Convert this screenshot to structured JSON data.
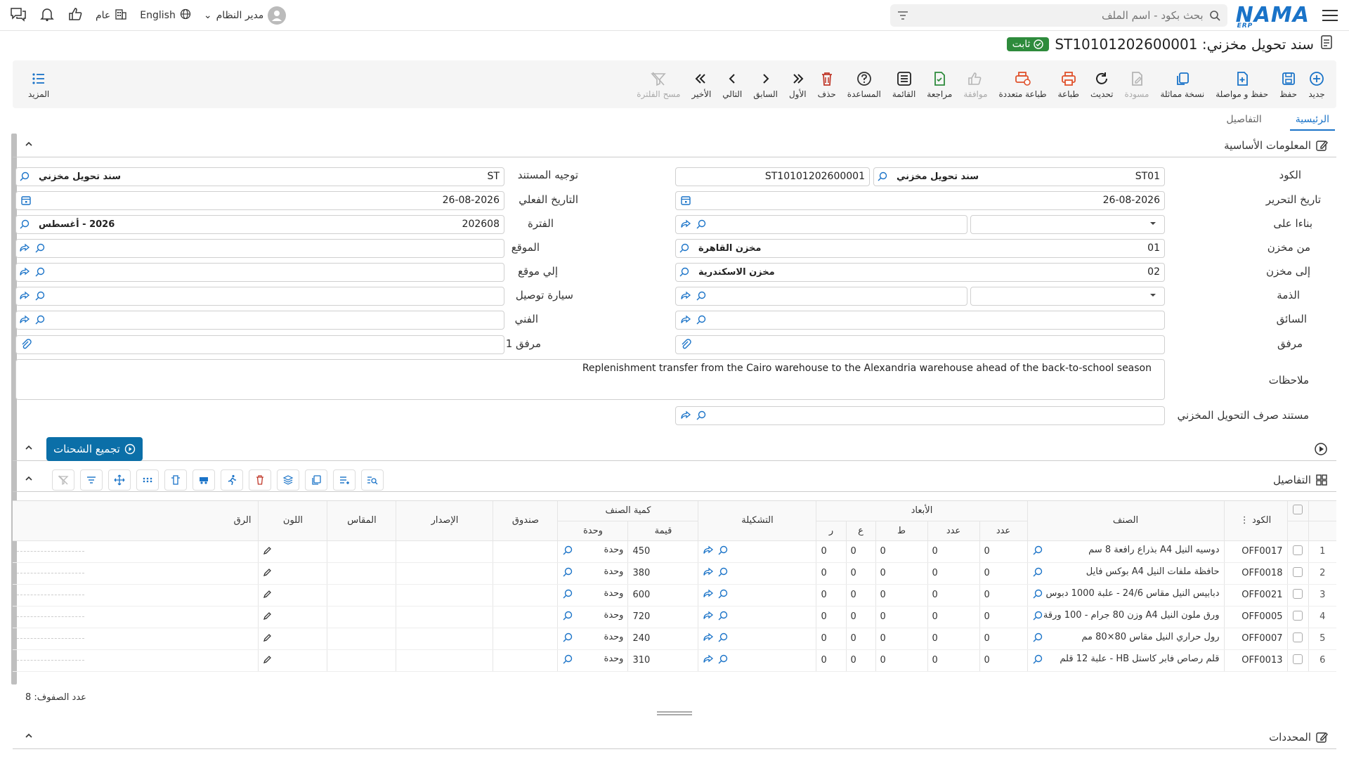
{
  "topbar": {
    "logo": "NAMA",
    "logo_sub": "ERP",
    "search_placeholder": "بحث بكود - اسم الملف",
    "user": "مدير النظام",
    "language": "English",
    "scope": "عام"
  },
  "title": {
    "text": "سند تحويل مخزني: ST10101202600001",
    "status": "ثابت"
  },
  "toolbar": {
    "items": [
      {
        "label": "جديد",
        "icon": "plus-circle-icon"
      },
      {
        "label": "حفظ",
        "icon": "save-icon"
      },
      {
        "label": "حفظ و مواصلة",
        "icon": "save-continue-icon"
      },
      {
        "label": "نسخة مماثلة",
        "icon": "copy-icon"
      },
      {
        "label": "مسودة",
        "icon": "draft-icon"
      },
      {
        "label": "تحديث",
        "icon": "refresh-icon"
      },
      {
        "label": "طباعة",
        "icon": "print-icon"
      },
      {
        "label": "طباعة متعددة",
        "icon": "multi-print-icon"
      },
      {
        "label": "موافقة",
        "icon": "thumbs-up-icon"
      },
      {
        "label": "مراجعة",
        "icon": "review-icon"
      },
      {
        "label": "القائمة",
        "icon": "list-icon"
      },
      {
        "label": "المساعدة",
        "icon": "help-icon"
      },
      {
        "label": "حذف",
        "icon": "trash-icon"
      },
      {
        "label": "الأول",
        "icon": "first-icon"
      },
      {
        "label": "السابق",
        "icon": "prev-icon"
      },
      {
        "label": "التالي",
        "icon": "next-icon"
      },
      {
        "label": "الأخير",
        "icon": "last-icon"
      },
      {
        "label": "مسح الفلترة",
        "icon": "clear-filter-icon"
      }
    ],
    "more": "المزيد"
  },
  "tabs": [
    "الرئيسية",
    "التفاصيل"
  ],
  "basic_section": "المعلومات الأساسية",
  "form": {
    "code_label": "الكود",
    "code_value": "ST01",
    "code_name": "سند تحويل مخزني",
    "code_number": "ST10101202600001",
    "doc_direction_label": "توجيه المستند",
    "doc_direction_value": "ST",
    "doc_direction_name": "سند تحويل مخزني",
    "edit_date_label": "تاريخ التحرير",
    "edit_date_value": "26-08-2026",
    "actual_date_label": "التاريخ الفعلي",
    "actual_date_value": "26-08-2026",
    "based_on_label": "بناءا على",
    "period_label": "الفترة",
    "period_value": "202608",
    "period_name": "2026 - أغسطس",
    "from_store_label": "من مخزن",
    "from_store_code": "01",
    "from_store_name": "مخزن القاهرة",
    "location_label": "الموقع",
    "to_store_label": "إلى مخزن",
    "to_store_code": "02",
    "to_store_name": "مخزن الاسكندرية",
    "to_location_label": "إلي موقع",
    "account_label": "الذمة",
    "vehicle_label": "سيارة توصيل",
    "driver_label": "السائق",
    "technician_label": "الفني",
    "attachment_label": "مرفق",
    "attachment1_label": "مرفق 1",
    "notes_label": "ملاحظات",
    "notes_value": "Replenishment transfer from the Cairo warehouse to the Alexandria warehouse ahead of the back-to-school season",
    "issue_doc_label": "مستند صرف التحويل المخزني"
  },
  "shipments_button": "تجميع الشحنات",
  "details_section": "التفاصيل",
  "grid": {
    "headers": {
      "code": "الكود",
      "item": "الصنف",
      "dimensions": "الأبعاد",
      "count1": "عدد",
      "count2": "عدد",
      "length": "ط",
      "width": "ع",
      "radius": "ر",
      "config": "التشكيلة",
      "qty_group": "كمية الصنف",
      "value": "قيمة",
      "unit": "وحدة",
      "box": "صندوق",
      "version": "الإصدار",
      "size": "المقاس",
      "color": "اللون",
      "serial": "الرق"
    },
    "rows": [
      {
        "n": "1",
        "code": "OFF0017",
        "item": "دوسيه النيل A4 بذراع رافعة 8 سم",
        "c1": "0",
        "c2": "0",
        "l": "0",
        "w": "0",
        "r": "0",
        "value": "450",
        "unit": "وحدة"
      },
      {
        "n": "2",
        "code": "OFF0018",
        "item": "حافظة ملفات النيل A4 بوكس فايل",
        "c1": "0",
        "c2": "0",
        "l": "0",
        "w": "0",
        "r": "0",
        "value": "380",
        "unit": "وحدة"
      },
      {
        "n": "3",
        "code": "OFF0021",
        "item": "دبابيس النيل مقاس 24/6 - علبة 1000 دبوس",
        "c1": "0",
        "c2": "0",
        "l": "0",
        "w": "0",
        "r": "0",
        "value": "600",
        "unit": "وحدة"
      },
      {
        "n": "4",
        "code": "OFF0005",
        "item": "ورق ملون النيل A4 وزن 80 جرام - 100 ورقة",
        "c1": "0",
        "c2": "0",
        "l": "0",
        "w": "0",
        "r": "0",
        "value": "720",
        "unit": "وحدة"
      },
      {
        "n": "5",
        "code": "OFF0007",
        "item": "رول حراري النيل مقاس 80×80 مم",
        "c1": "0",
        "c2": "0",
        "l": "0",
        "w": "0",
        "r": "0",
        "value": "240",
        "unit": "وحدة"
      },
      {
        "n": "6",
        "code": "OFF0013",
        "item": "قلم رصاص فابر كاستل HB - علبة 12 قلم",
        "c1": "0",
        "c2": "0",
        "l": "0",
        "w": "0",
        "r": "0",
        "value": "310",
        "unit": "وحدة"
      }
    ],
    "row_count": "عدد الصفوف: 8"
  },
  "determinants_section": "المحددات",
  "colors": {
    "accent": "#1a73c8",
    "status": "#2e8b3c",
    "shipments": "#0b6fa8",
    "delete": "#c0392b"
  }
}
